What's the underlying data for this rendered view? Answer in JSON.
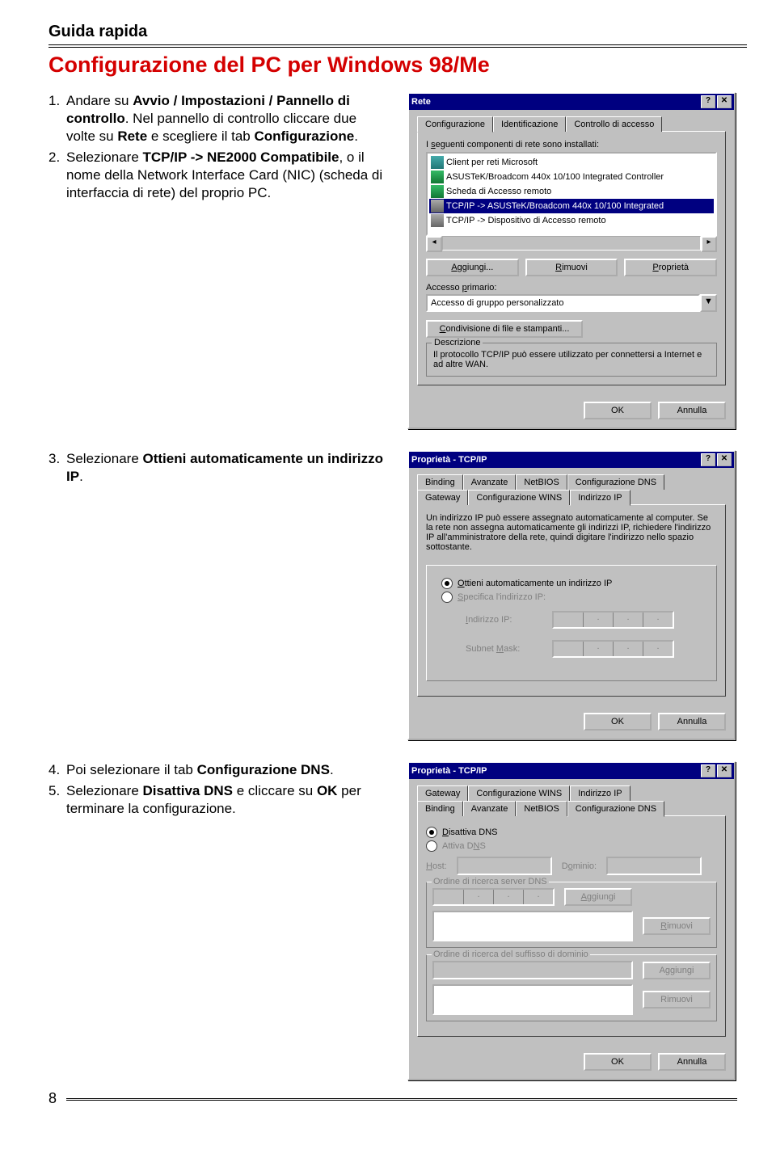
{
  "header": "Guida rapida",
  "title": "Configurazione del PC per Windows 98/Me",
  "page_number": "8",
  "steps": {
    "s1": {
      "num": "1.",
      "pre": "Andare su ",
      "b1": "Avvio / Impostazioni / Pannello di controllo",
      "mid": ". Nel pannello di controllo cliccare due volte su ",
      "b2": "Rete",
      "mid2": " e scegliere il tab ",
      "b3": "Configurazione",
      "post": "."
    },
    "s2": {
      "num": "2.",
      "pre": "Selezionare ",
      "b1": "TCP/IP -> NE2000 Compatibile",
      "post": ", o il nome della Network Interface Card (NIC) (scheda di interfaccia di rete) del proprio PC."
    },
    "s3": {
      "num": "3.",
      "pre": "Selezionare ",
      "b1": "Ottieni automaticamente un indirizzo IP",
      "post": "."
    },
    "s4": {
      "num": "4.",
      "pre": "Poi selezionare il tab ",
      "b1": "Configurazione DNS",
      "post": "."
    },
    "s5": {
      "num": "5.",
      "pre": "Selezionare ",
      "b1": "Disattiva DNS",
      "mid": " e cliccare su ",
      "b2": "OK",
      "post": " per terminare la configurazione."
    }
  },
  "dlg1": {
    "title": "Rete",
    "help_btn": "?",
    "close_btn": "✕",
    "tabs": {
      "t1": "Configurazione",
      "t2": "Identificazione",
      "t3": "Controllo di accesso"
    },
    "list_label_pre": "I ",
    "list_label_u": "s",
    "list_label_post": "eguenti componenti di rete sono installati:",
    "items": {
      "i0": "Client per reti Microsoft",
      "i1": "ASUSTeK/Broadcom 440x 10/100 Integrated Controller",
      "i2": "Scheda di Accesso remoto",
      "i3": "TCP/IP -> ASUSTeK/Broadcom 440x 10/100 Integrated",
      "i4": "TCP/IP -> Dispositivo di Accesso remoto"
    },
    "btns": {
      "add_u": "A",
      "add": "ggiungi...",
      "rem_u": "R",
      "rem": "imuovi",
      "prop_u": "P",
      "prop": "roprietà"
    },
    "access_label_pre": "Accesso ",
    "access_label_u": "p",
    "access_label_post": "rimario:",
    "access_value": "Accesso di gruppo personalizzato",
    "share_u": "C",
    "share": "ondivisione di file e stampanti...",
    "desc_label": "Descrizione",
    "desc_text": "Il protocollo TCP/IP può essere utilizzato per connettersi a Internet e ad altre WAN.",
    "ok": "OK",
    "cancel": "Annulla"
  },
  "dlg2": {
    "title": "Proprietà - TCP/IP",
    "tabs_row1": {
      "t1": "Binding",
      "t2": "Avanzate",
      "t3": "NetBIOS",
      "t4": "Configurazione DNS"
    },
    "tabs_row2": {
      "t1": "Gateway",
      "t2": "Configurazione WINS",
      "t3": "Indirizzo IP"
    },
    "intro": "Un indirizzo IP può essere assegnato automaticamente al computer. Se la rete non assegna automaticamente gli indirizzi IP, richiedere l'indirizzo IP all'amministratore della rete, quindi digitare l'indirizzo nello spazio sottostante.",
    "r1_u": "O",
    "r1": "ttieni automaticamente un indirizzo IP",
    "r2_u": "S",
    "r2": "pecifica l'indirizzo IP:",
    "ip_label_u1": "I",
    "ip_label": "ndirizzo IP:",
    "mask_label": "Subnet ",
    "mask_label_u": "M",
    "mask_label_post": "ask:",
    "ok": "OK",
    "cancel": "Annulla"
  },
  "dlg3": {
    "title": "Proprietà - TCP/IP",
    "tabs_row1": {
      "t1": "Gateway",
      "t2": "Configurazione WINS",
      "t3": "Indirizzo IP"
    },
    "tabs_row2": {
      "t1": "Binding",
      "t2": "Avanzate",
      "t3": "NetBIOS",
      "t4": "Configurazione DNS"
    },
    "r1_u": "D",
    "r1": "isattiva DNS",
    "r2": "Attiva D",
    "r2_u": "N",
    "r2_post": "S",
    "host_u": "H",
    "host": "ost:",
    "domain": "D",
    "domain_u": "o",
    "domain_post": "minio:",
    "order1": "Ordine di ricerca server DNS",
    "order2": "Ordine di ricerca del suffisso di dominio",
    "add_u": "A",
    "add": "ggiungi",
    "rem_u": "R",
    "rem": "imuovi",
    "add2": "Aggiungi",
    "rem2": "Rimuovi",
    "ok": "OK",
    "cancel": "Annulla"
  }
}
